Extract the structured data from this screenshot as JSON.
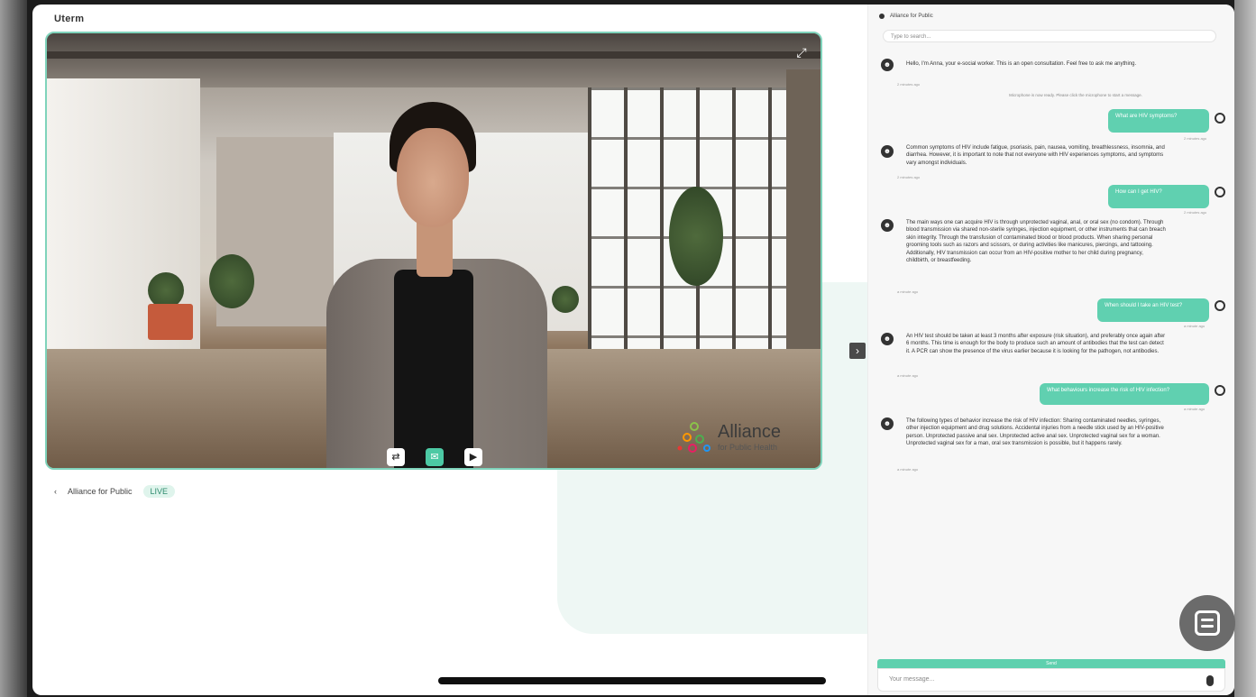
{
  "app": {
    "title": "Uterm"
  },
  "video": {
    "expand_icon": "expand-icon",
    "logo_name": "Alliance",
    "logo_sub": "for Public Health",
    "controls": [
      "repeat-icon",
      "chat-icon",
      "play-icon"
    ]
  },
  "meta": {
    "back_icon": "‹",
    "channel": "Alliance for Public",
    "status": "LIVE"
  },
  "chat": {
    "header": "Alliance for Public",
    "search_placeholder": "Type to search...",
    "system_note": "Microphone is now ready. Please click the microphone to start a message.",
    "messages": [
      {
        "role": "bot",
        "text": "Hello, I'm Anna, your e-social worker. This is an open consultation. Feel free to ask me anything.",
        "time": "2 minutes ago"
      },
      {
        "role": "user",
        "text": "What are HIV symptoms?",
        "time": "2 minutes ago"
      },
      {
        "role": "bot",
        "text": "Common symptoms of HIV include fatigue, psoriasis, pain, nausea, vomiting, breathlessness, insomnia, and diarrhea. However, it is important to note that not everyone with HIV experiences symptoms, and symptoms vary amongst individuals.",
        "time": "2 minutes ago"
      },
      {
        "role": "user",
        "text": "How can I get HIV?",
        "time": "2 minutes ago"
      },
      {
        "role": "bot",
        "text": "The main ways one can acquire HIV is through unprotected vaginal, anal, or oral sex (no condom). Through blood transmission via shared non-sterile syringes, injection equipment, or other instruments that can breach skin integrity. Through the transfusion of contaminated blood or blood products. When sharing personal grooming tools such as razors and scissors, or during activities like manicures, piercings, and tattooing. Additionally, HIV transmission can occur from an HIV-positive mother to her child during pregnancy, childbirth, or breastfeeding.",
        "time": "a minute ago"
      },
      {
        "role": "user",
        "text": "When should I take an HIV test?",
        "time": "a minute ago"
      },
      {
        "role": "bot",
        "text": "An HIV test should be taken at least 3 months after exposure (risk situation), and preferably once again after 6 months. This time is enough for the body to produce such an amount of antibodies that the test can detect it. A PCR can show the presence of the virus earlier because it is looking for the pathogen, not antibodies.",
        "time": "a minute ago"
      },
      {
        "role": "user",
        "text": "What behaviours increase the risk of HIV infection?",
        "time": "a minute ago"
      },
      {
        "role": "bot",
        "text": "The following types of behavior increase the risk of HIV infection: Sharing contaminated needles, syringes, other injection equipment and drug solutions. Accidental injuries from a needle stick used by an HIV-positive person. Unprotected passive anal sex. Unprotected active anal sex. Unprotected vaginal sex for a woman. Unprotected vaginal sex for a man, oral sex transmission is possible, but it happens rarely.",
        "time": "a minute ago"
      }
    ],
    "send_label": "Send",
    "input_placeholder": "Your message..."
  }
}
